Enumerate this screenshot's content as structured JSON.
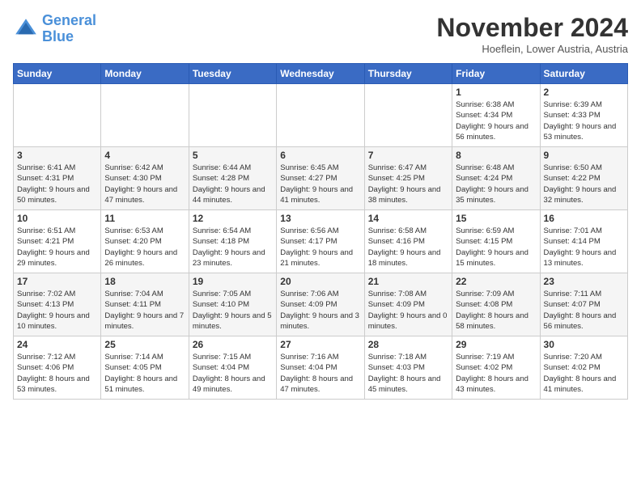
{
  "logo": {
    "line1": "General",
    "line2": "Blue"
  },
  "header": {
    "month": "November 2024",
    "location": "Hoeflein, Lower Austria, Austria"
  },
  "days_of_week": [
    "Sunday",
    "Monday",
    "Tuesday",
    "Wednesday",
    "Thursday",
    "Friday",
    "Saturday"
  ],
  "weeks": [
    [
      {
        "day": "",
        "info": ""
      },
      {
        "day": "",
        "info": ""
      },
      {
        "day": "",
        "info": ""
      },
      {
        "day": "",
        "info": ""
      },
      {
        "day": "",
        "info": ""
      },
      {
        "day": "1",
        "info": "Sunrise: 6:38 AM\nSunset: 4:34 PM\nDaylight: 9 hours and 56 minutes."
      },
      {
        "day": "2",
        "info": "Sunrise: 6:39 AM\nSunset: 4:33 PM\nDaylight: 9 hours and 53 minutes."
      }
    ],
    [
      {
        "day": "3",
        "info": "Sunrise: 6:41 AM\nSunset: 4:31 PM\nDaylight: 9 hours and 50 minutes."
      },
      {
        "day": "4",
        "info": "Sunrise: 6:42 AM\nSunset: 4:30 PM\nDaylight: 9 hours and 47 minutes."
      },
      {
        "day": "5",
        "info": "Sunrise: 6:44 AM\nSunset: 4:28 PM\nDaylight: 9 hours and 44 minutes."
      },
      {
        "day": "6",
        "info": "Sunrise: 6:45 AM\nSunset: 4:27 PM\nDaylight: 9 hours and 41 minutes."
      },
      {
        "day": "7",
        "info": "Sunrise: 6:47 AM\nSunset: 4:25 PM\nDaylight: 9 hours and 38 minutes."
      },
      {
        "day": "8",
        "info": "Sunrise: 6:48 AM\nSunset: 4:24 PM\nDaylight: 9 hours and 35 minutes."
      },
      {
        "day": "9",
        "info": "Sunrise: 6:50 AM\nSunset: 4:22 PM\nDaylight: 9 hours and 32 minutes."
      }
    ],
    [
      {
        "day": "10",
        "info": "Sunrise: 6:51 AM\nSunset: 4:21 PM\nDaylight: 9 hours and 29 minutes."
      },
      {
        "day": "11",
        "info": "Sunrise: 6:53 AM\nSunset: 4:20 PM\nDaylight: 9 hours and 26 minutes."
      },
      {
        "day": "12",
        "info": "Sunrise: 6:54 AM\nSunset: 4:18 PM\nDaylight: 9 hours and 23 minutes."
      },
      {
        "day": "13",
        "info": "Sunrise: 6:56 AM\nSunset: 4:17 PM\nDaylight: 9 hours and 21 minutes."
      },
      {
        "day": "14",
        "info": "Sunrise: 6:58 AM\nSunset: 4:16 PM\nDaylight: 9 hours and 18 minutes."
      },
      {
        "day": "15",
        "info": "Sunrise: 6:59 AM\nSunset: 4:15 PM\nDaylight: 9 hours and 15 minutes."
      },
      {
        "day": "16",
        "info": "Sunrise: 7:01 AM\nSunset: 4:14 PM\nDaylight: 9 hours and 13 minutes."
      }
    ],
    [
      {
        "day": "17",
        "info": "Sunrise: 7:02 AM\nSunset: 4:13 PM\nDaylight: 9 hours and 10 minutes."
      },
      {
        "day": "18",
        "info": "Sunrise: 7:04 AM\nSunset: 4:11 PM\nDaylight: 9 hours and 7 minutes."
      },
      {
        "day": "19",
        "info": "Sunrise: 7:05 AM\nSunset: 4:10 PM\nDaylight: 9 hours and 5 minutes."
      },
      {
        "day": "20",
        "info": "Sunrise: 7:06 AM\nSunset: 4:09 PM\nDaylight: 9 hours and 3 minutes."
      },
      {
        "day": "21",
        "info": "Sunrise: 7:08 AM\nSunset: 4:09 PM\nDaylight: 9 hours and 0 minutes."
      },
      {
        "day": "22",
        "info": "Sunrise: 7:09 AM\nSunset: 4:08 PM\nDaylight: 8 hours and 58 minutes."
      },
      {
        "day": "23",
        "info": "Sunrise: 7:11 AM\nSunset: 4:07 PM\nDaylight: 8 hours and 56 minutes."
      }
    ],
    [
      {
        "day": "24",
        "info": "Sunrise: 7:12 AM\nSunset: 4:06 PM\nDaylight: 8 hours and 53 minutes."
      },
      {
        "day": "25",
        "info": "Sunrise: 7:14 AM\nSunset: 4:05 PM\nDaylight: 8 hours and 51 minutes."
      },
      {
        "day": "26",
        "info": "Sunrise: 7:15 AM\nSunset: 4:04 PM\nDaylight: 8 hours and 49 minutes."
      },
      {
        "day": "27",
        "info": "Sunrise: 7:16 AM\nSunset: 4:04 PM\nDaylight: 8 hours and 47 minutes."
      },
      {
        "day": "28",
        "info": "Sunrise: 7:18 AM\nSunset: 4:03 PM\nDaylight: 8 hours and 45 minutes."
      },
      {
        "day": "29",
        "info": "Sunrise: 7:19 AM\nSunset: 4:02 PM\nDaylight: 8 hours and 43 minutes."
      },
      {
        "day": "30",
        "info": "Sunrise: 7:20 AM\nSunset: 4:02 PM\nDaylight: 8 hours and 41 minutes."
      }
    ]
  ]
}
